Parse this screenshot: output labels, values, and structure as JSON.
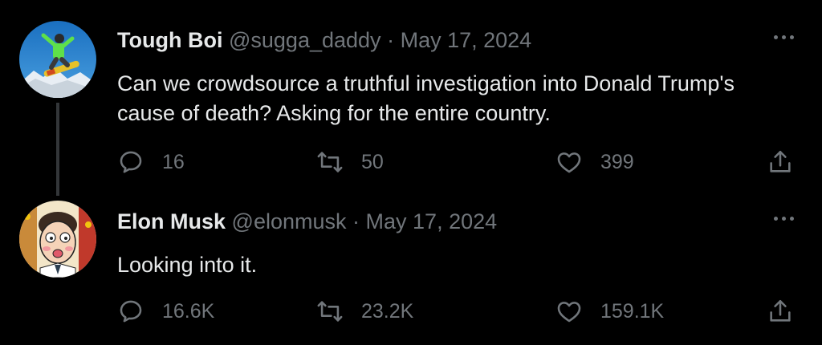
{
  "colors": {
    "background": "#000000",
    "primary_text": "#e7e9ea",
    "secondary_text": "#71767b",
    "thread_line": "#333639"
  },
  "tweets": [
    {
      "author": "Tough Boi",
      "handle": "@sugga_daddy",
      "separator": "·",
      "date": "May 17, 2024",
      "text": "Can we crowdsource a truthful investigation into Donald Trump's cause of death? Asking for the entire country.",
      "replies": "16",
      "retweets": "50",
      "likes": "399",
      "avatar_icon": "snowboarder-avatar"
    },
    {
      "author": "Elon Musk",
      "handle": "@elonmusk",
      "separator": "·",
      "date": "May 17, 2024",
      "text": "Looking into it.",
      "replies": "16.6K",
      "retweets": "23.2K",
      "likes": "159.1K",
      "avatar_icon": "cartoon-face-avatar"
    }
  ],
  "icons": {
    "reply": "reply-icon",
    "retweet": "retweet-icon",
    "like": "heart-icon",
    "share": "share-icon",
    "more": "more-options-icon"
  }
}
